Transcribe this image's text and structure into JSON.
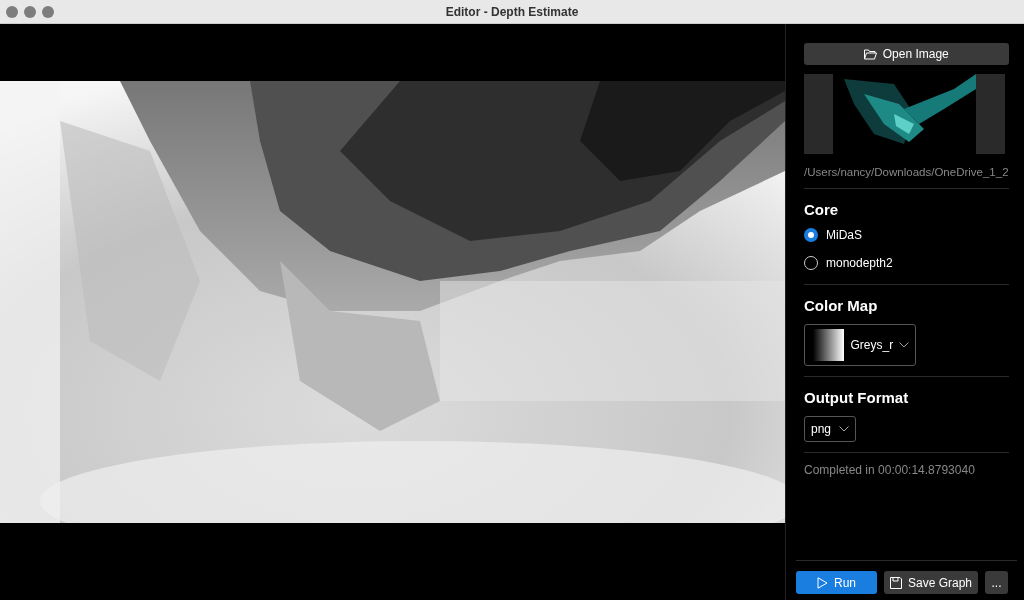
{
  "window": {
    "title": "Editor - Depth Estimate"
  },
  "open_button": {
    "label": "Open Image"
  },
  "file_path": "/Users/nancy/Downloads/OneDrive_1_2",
  "core": {
    "title": "Core",
    "options": [
      {
        "label": "MiDaS",
        "selected": true
      },
      {
        "label": "monodepth2",
        "selected": false
      }
    ]
  },
  "color_map": {
    "title": "Color Map",
    "value": "Greys_r"
  },
  "output_format": {
    "title": "Output Format",
    "value": "png"
  },
  "status": "Completed in 00:00:14.8793040",
  "buttons": [
    {
      "label": "Run",
      "kind": "primary"
    },
    {
      "label": "Save Graph",
      "kind": "save"
    },
    {
      "label": "...",
      "kind": "more"
    }
  ]
}
